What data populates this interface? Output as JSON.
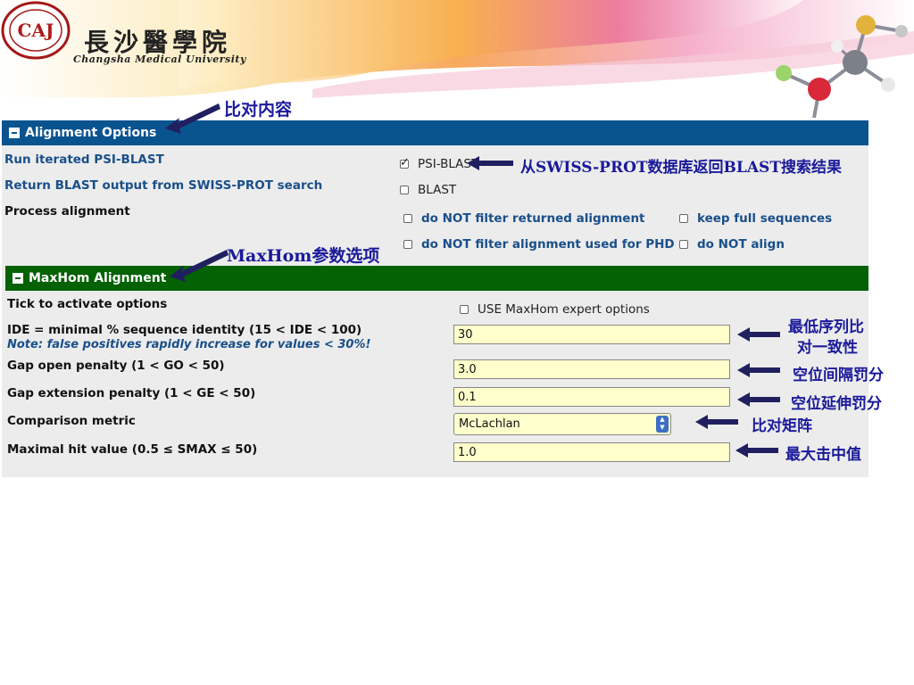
{
  "header": {
    "university_cn": "長沙醫學院",
    "university_en": "Changsha Medical University",
    "logo_letters": "CAJ"
  },
  "alignment_options": {
    "title": "Alignment Options",
    "run_psi_label": "Run iterated PSI-BLAST",
    "return_blast_label": "Return BLAST output from SWISS-PROT search",
    "process_label": "Process alignment",
    "psi_blast_checkbox": {
      "label": "PSI-BLAST",
      "checked": true
    },
    "blast_checkbox": {
      "label": "BLAST",
      "checked": false
    },
    "no_filter_returned": {
      "label": "do NOT filter returned alignment",
      "checked": false
    },
    "keep_full": {
      "label": "keep full sequences",
      "checked": false
    },
    "no_filter_phd": {
      "label": "do NOT filter alignment used for PHD",
      "checked": false
    },
    "no_align": {
      "label": "do NOT align",
      "checked": false
    }
  },
  "maxhom": {
    "title": "MaxHom Alignment",
    "tick_label": "Tick to activate options",
    "expert_checkbox": {
      "label": "USE MaxHom expert options",
      "checked": false
    },
    "ide_label": "IDE = minimal % sequence identity (15 < IDE < 100)",
    "ide_note": "Note: false positives rapidly increase for values < 30%!",
    "ide_value": "30",
    "gap_open_label": "Gap open penalty (1 < GO < 50)",
    "gap_open_value": "3.0",
    "gap_ext_label": "Gap extension penalty (1 < GE < 50)",
    "gap_ext_value": "0.1",
    "metric_label": "Comparison metric",
    "metric_value": "McLachlan",
    "smax_label": "Maximal hit value (0.5 ≤ SMAX ≤ 50)",
    "smax_value": "1.0"
  },
  "annotations": {
    "content": "比对内容",
    "swissprot": "从SWISS-PROT数据库返回BLAST搜索结果",
    "maxhom_params": "MaxHom参数选项",
    "ide_line1": "最低序列比",
    "ide_line2": "对一致性",
    "gap_open": "空位间隔罚分",
    "gap_ext": "空位延伸罚分",
    "metric": "比对矩阵",
    "smax": "最大击中值"
  },
  "colors": {
    "alignment_bar": "#09538f",
    "maxhom_bar": "#046104",
    "input_bg": "#ffffcc",
    "annotation": "#1a1a9a"
  }
}
